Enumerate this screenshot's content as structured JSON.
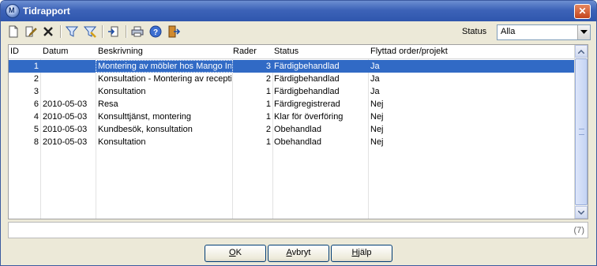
{
  "window": {
    "title": "Tidrapport",
    "app_icon_letter": "M"
  },
  "toolbar": {
    "status_label": "Status",
    "status_value": "Alla",
    "icons": [
      "new-icon",
      "edit-icon",
      "delete-icon",
      "filter-icon",
      "clear-filter-icon",
      "move-icon",
      "print-icon",
      "help-icon",
      "exit-icon"
    ]
  },
  "table": {
    "headers": [
      "ID",
      "Datum",
      "Beskrivning",
      "Rader",
      "Status",
      "Flyttad order/projekt"
    ],
    "rows": [
      [
        "1",
        "",
        "Montering av möbler hos Mango Int",
        "3",
        "Färdigbehandlad",
        "Ja"
      ],
      [
        "2",
        "",
        "Konsultation - Montering av receptio",
        "2",
        "Färdigbehandlad",
        "Ja"
      ],
      [
        "3",
        "",
        "Konsultation",
        "1",
        "Färdigbehandlad",
        "Ja"
      ],
      [
        "6",
        "2010-05-03",
        "Resa",
        "1",
        "Färdigregistrerad",
        "Nej"
      ],
      [
        "4",
        "2010-05-03",
        "Konsulttjänst, montering",
        "1",
        "Klar för överföring",
        "Nej"
      ],
      [
        "5",
        "2010-05-03",
        "Kundbesök, konsultation",
        "2",
        "Obehandlad",
        "Nej"
      ],
      [
        "8",
        "2010-05-03",
        "Konsultation",
        "1",
        "Obehandlad",
        "Nej"
      ]
    ]
  },
  "footer": {
    "count": "(7)"
  },
  "buttons": {
    "ok_first": "O",
    "ok_rest": "K",
    "cancel_first": "A",
    "cancel_rest": "vbryt",
    "help_first": "H",
    "help_rest": "jälp"
  },
  "colors": {
    "selection": "#316ac5",
    "titlebar": "#3d63b8"
  }
}
